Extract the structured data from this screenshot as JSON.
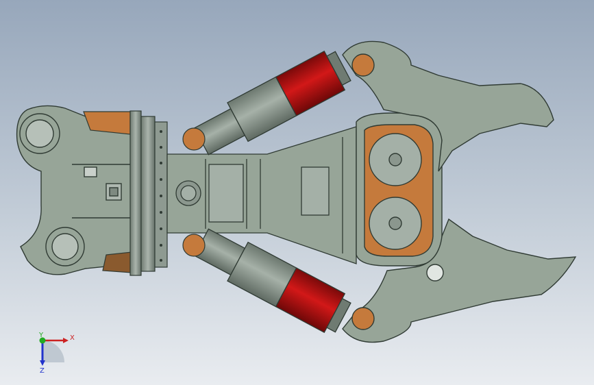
{
  "viewport": {
    "background_top": "#97a7bb",
    "background_bottom": "#e9ecf0"
  },
  "colors": {
    "body": "#97a598",
    "body_dark": "#6f7d72",
    "outline": "#2f3a33",
    "cylinder_red": "#b81414",
    "cylinder_gray": "#8f9b92",
    "bronze": "#c57a3c",
    "brown": "#8a5a2e"
  },
  "axis_triad": {
    "x_label": "X",
    "y_label": "Y",
    "z_label": "Z",
    "x_color": "#cc2222",
    "y_color": "#22aa22",
    "z_color": "#2233cc"
  }
}
